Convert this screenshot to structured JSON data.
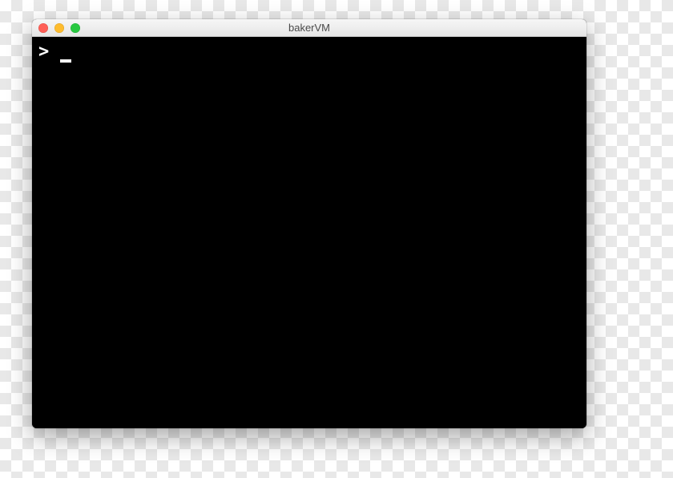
{
  "window": {
    "title": "bakerVM",
    "traffic_light_colors": {
      "close": "#ff5f57",
      "minimize": "#febc2e",
      "maximize": "#28c840"
    }
  },
  "terminal": {
    "prompt": ">",
    "input": "",
    "cursor_visible": true
  }
}
